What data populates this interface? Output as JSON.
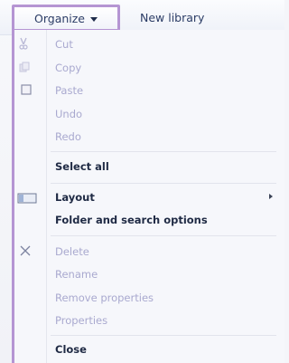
{
  "command_bar": {
    "organize_label": "Organize",
    "new_library_label": "New library"
  },
  "organize_menu": {
    "items": [
      {
        "label": "Cut",
        "enabled": false,
        "icon": "scissors-icon"
      },
      {
        "label": "Copy",
        "enabled": false,
        "icon": "copy-icon"
      },
      {
        "label": "Paste",
        "enabled": false,
        "icon": "paste-icon"
      },
      {
        "label": "Undo",
        "enabled": false
      },
      {
        "label": "Redo",
        "enabled": false
      },
      {
        "label": "Select all",
        "enabled": true
      },
      {
        "label": "Layout",
        "enabled": true,
        "icon": "layout-icon",
        "has_submenu": true
      },
      {
        "label": "Folder and search options",
        "enabled": true
      },
      {
        "label": "Delete",
        "enabled": false,
        "icon": "delete-x-icon"
      },
      {
        "label": "Rename",
        "enabled": false
      },
      {
        "label": "Remove properties",
        "enabled": false
      },
      {
        "label": "Properties",
        "enabled": false
      },
      {
        "label": "Close",
        "enabled": true
      }
    ]
  },
  "colors": {
    "highlight_border": "#b595d3",
    "disabled_text": "#a9a9cf",
    "enabled_text": "#1f2a44"
  }
}
